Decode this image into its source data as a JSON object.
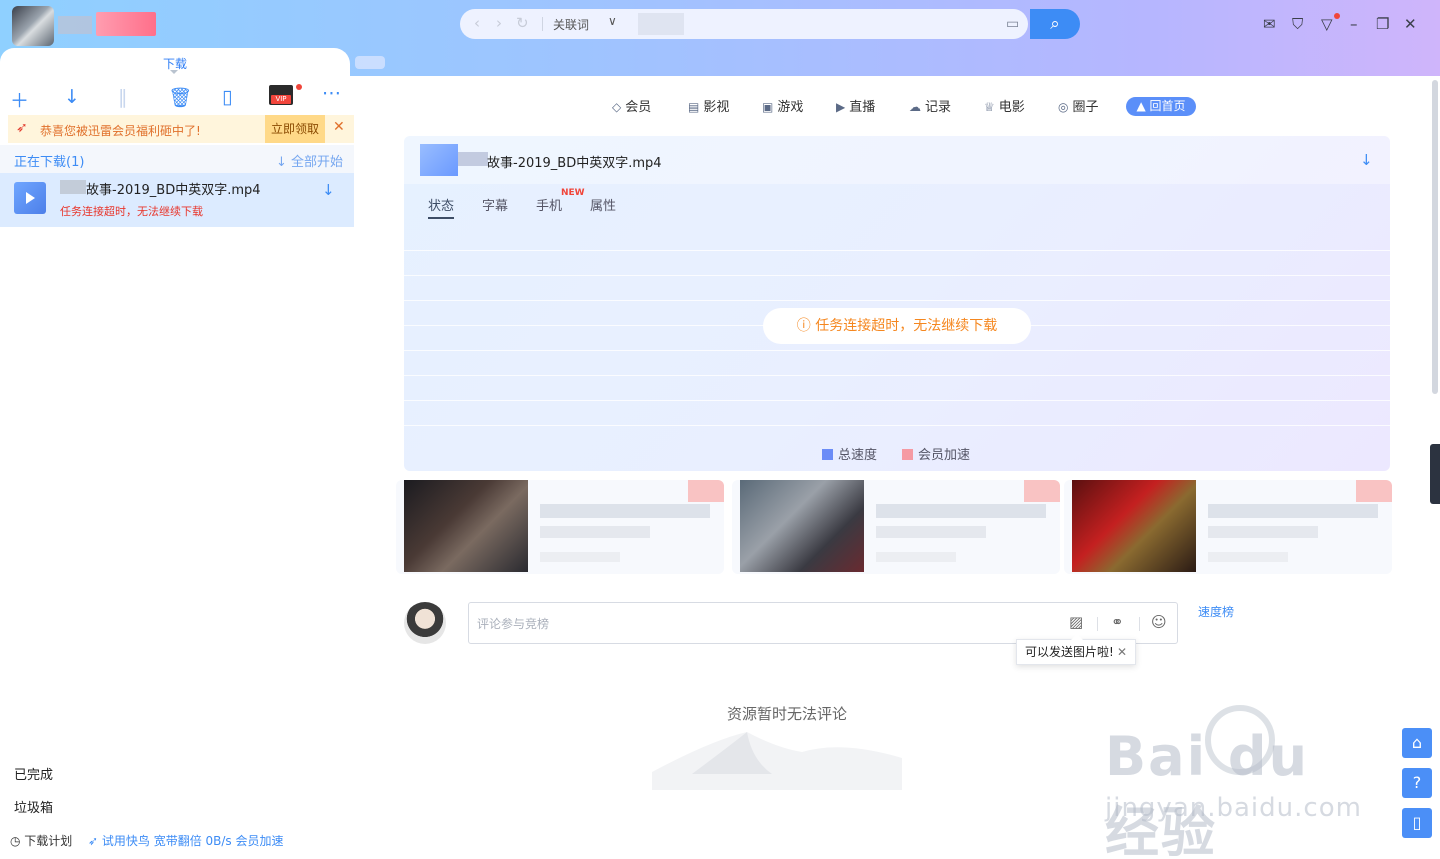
{
  "top": {
    "panel_tab": "下载",
    "address": {
      "keyword_label": "关联词"
    },
    "icons": [
      "back-icon",
      "forward-icon",
      "refresh-icon",
      "chevron-down-icon",
      "screen-icon",
      "search-icon",
      "mail-icon",
      "shirt-icon",
      "menu-icon",
      "minimize-icon",
      "restore-icon",
      "close-icon"
    ]
  },
  "left": {
    "toolbar": [
      "add-icon",
      "download-icon",
      "pause-icon",
      "trash-icon",
      "phone-icon",
      "vip-icon",
      "more-icon"
    ],
    "vip_badge": "VIP",
    "promo": {
      "text": "恭喜您被迅雷会员福利砸中了!",
      "button": "立即领取",
      "close": "✕"
    },
    "section": {
      "title": "正在下载(1)",
      "action": "全部开始"
    },
    "task": {
      "name": "故事-2019_BD中英双字.mp4",
      "error": "任务连接超时，无法继续下载"
    },
    "links": {
      "completed": "已完成",
      "trash": "垃圾箱"
    },
    "bottom": {
      "plan": "下载计划",
      "promo": "试用快鸟 宽带翻倍 0B/s 会员加速"
    }
  },
  "nav": {
    "items": [
      {
        "label": "会员",
        "icon": "diamond-icon"
      },
      {
        "label": "影视",
        "icon": "film-icon"
      },
      {
        "label": "游戏",
        "icon": "game-icon"
      },
      {
        "label": "直播",
        "icon": "live-icon"
      },
      {
        "label": "记录",
        "icon": "cloud-icon"
      },
      {
        "label": "电影",
        "icon": "trophy-icon"
      },
      {
        "label": "圈子",
        "icon": "circle-icon"
      }
    ],
    "home": "回首页"
  },
  "detail": {
    "file_name": "故事-2019_BD中英双字.mp4",
    "tabs": [
      "状态",
      "字幕",
      "手机",
      "属性"
    ],
    "new_badge": "NEW",
    "warning": "任务连接超时，无法继续下载",
    "legend": {
      "total": "总速度",
      "vip": "会员加速"
    },
    "colors": {
      "total": "#6b8cf7",
      "vip": "#f59aa3"
    }
  },
  "comment": {
    "placeholder": "评论参与竞榜",
    "speed_rank": "速度榜",
    "tip": "可以发送图片啦!",
    "empty": "资源暂时无法评论"
  },
  "floating": [
    "home-icon",
    "help-icon",
    "mobile-icon"
  ],
  "watermark": {
    "line1": "Bai du 经验",
    "line2": "jingyan.baidu.com"
  }
}
